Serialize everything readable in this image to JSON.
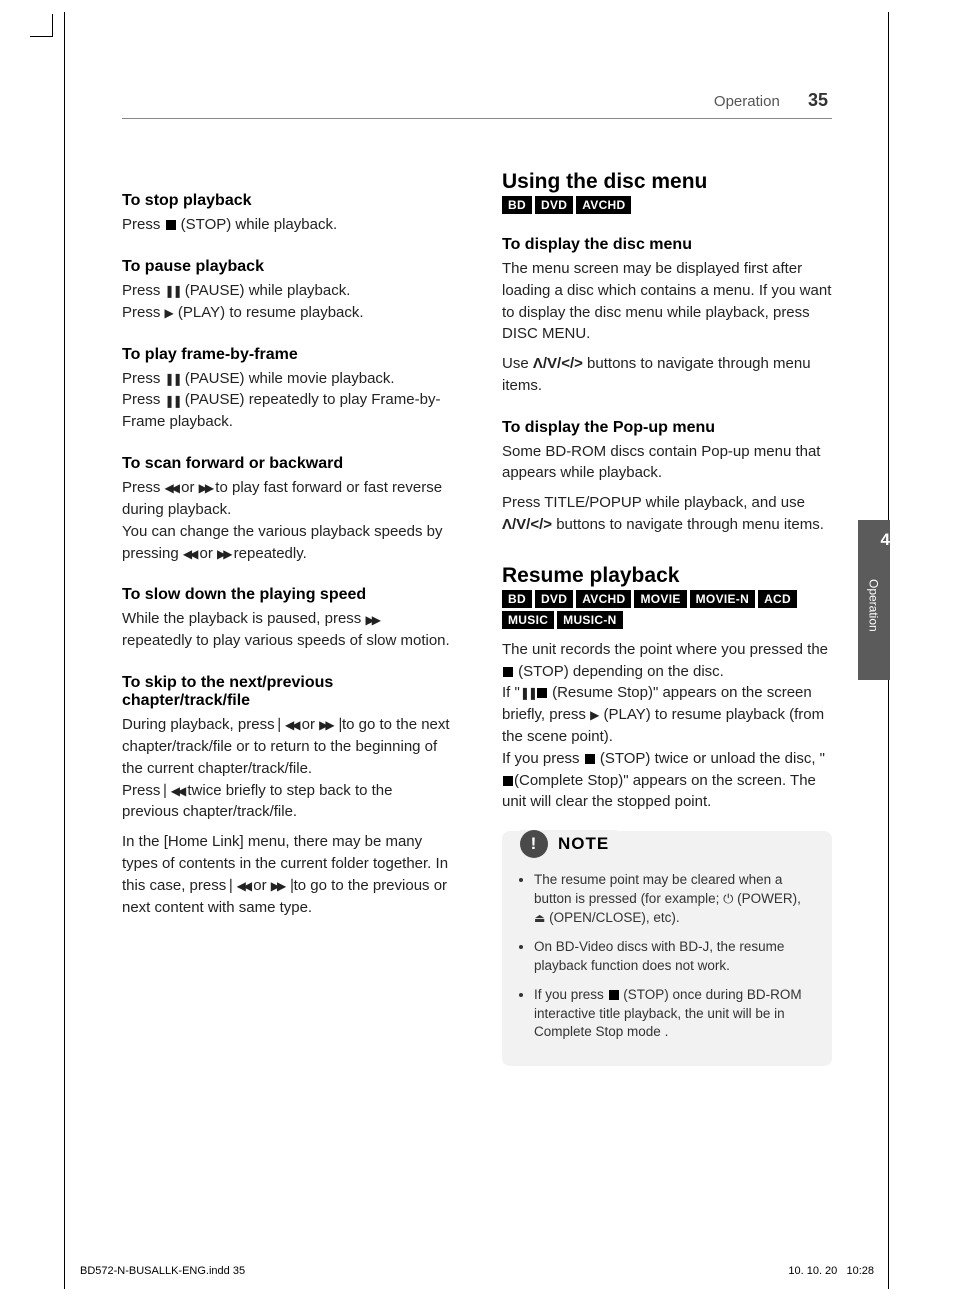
{
  "header": {
    "section": "Operation",
    "page": "35"
  },
  "sideTab": {
    "num": "4",
    "label": "Operation"
  },
  "left": {
    "s1": {
      "h": "To stop playback",
      "p1a": "Press ",
      "p1b": " (STOP) while playback."
    },
    "s2": {
      "h": "To pause playback",
      "p1a": "Press ",
      "p1b": " (PAUSE) while playback.",
      "p2a": "Press ",
      "p2b": " (PLAY) to resume playback."
    },
    "s3": {
      "h": "To play frame-by-frame",
      "p1a": "Press ",
      "p1b": " (PAUSE) while movie playback.",
      "p2a": "Press ",
      "p2b": " (PAUSE) repeatedly to play Frame-by-Frame playback."
    },
    "s4": {
      "h": "To scan forward or backward",
      "p1a": "Press ",
      "p1b": " or ",
      "p1c": " to play fast forward or fast reverse during playback.",
      "p2a": "You can change the various playback speeds by pressing ",
      "p2b": " or ",
      "p2c": " repeatedly."
    },
    "s5": {
      "h": "To slow down the playing speed",
      "p1a": "While the playback is paused, press ",
      "p1b": " repeatedly to play various speeds of slow motion."
    },
    "s6": {
      "h": "To skip to the next/previous chapter/track/file",
      "p1a": "During playback, press ",
      "p1b": " or ",
      "p1c": " to go to the next chapter/track/file or to return to the beginning of the current chapter/track/file.",
      "p2a": "Press ",
      "p2b": " twice briefly to step back to the previous chapter/track/file.",
      "p3a": "In the [Home Link] menu, there may be many types of contents in the current folder together. In this case, press ",
      "p3b": " or ",
      "p3c": " to go to the previous or next content with same type."
    }
  },
  "right": {
    "h1": "Using the disc menu",
    "chips1": [
      "BD",
      "DVD",
      "AVCHD"
    ],
    "s1": {
      "h": "To display the disc menu",
      "p1": "The menu screen may be displayed first after loading a disc which contains a menu. If you want to display the disc menu while playback, press DISC MENU.",
      "p2a": "Use ",
      "p2b": " buttons to navigate through menu items."
    },
    "s2": {
      "h": "To display the Pop-up menu",
      "p1": "Some BD-ROM discs contain Pop-up menu that appears while playback.",
      "p2a": "Press TITLE/POPUP while playback, and use ",
      "p2b": " buttons to navigate through menu items."
    },
    "h2": "Resume playback",
    "chips2": [
      "BD",
      "DVD",
      "AVCHD",
      "MOVIE",
      "MOVIE-N",
      "ACD",
      "MUSIC",
      "MUSIC-N"
    ],
    "s3": {
      "p1a": "The unit records the point where you pressed the ",
      "p1b": " (STOP) depending on the disc.",
      "p2a": "If \"",
      "p2b": " (Resume Stop)\" appears on the screen briefly, press ",
      "p2c": " (PLAY)  to resume playback (from the scene point).",
      "p3a": "If you press ",
      "p3b": " (STOP) twice or unload the disc, \"",
      "p3c": "(Complete Stop)\" appears on the screen. The unit will clear the stopped point."
    },
    "note": {
      "title": "NOTE",
      "n1a": "The resume point may be cleared when a button is pressed (for example; ",
      "n1b": " (POWER), ",
      "n1c": " (OPEN/CLOSE), etc).",
      "n2": "On BD-Video discs with BD-J, the resume playback function does not work.",
      "n3a": "If you press ",
      "n3b": " (STOP) once during BD-ROM interactive title playback, the unit will be in Complete Stop mode ."
    }
  },
  "footer": {
    "file": "BD572-N-BUSALLK-ENG.indd   35",
    "date": "10. 10. 20",
    "time": "10:28"
  }
}
